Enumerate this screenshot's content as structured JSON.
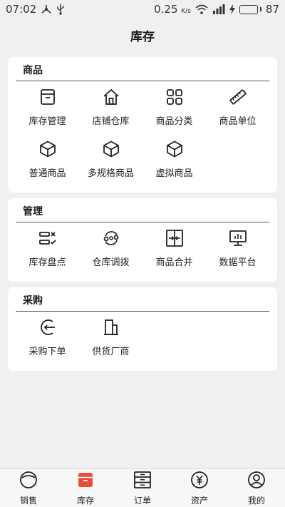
{
  "status_bar": {
    "time": "07:02",
    "speed": "0.25",
    "speed_unit": "K/s",
    "battery": "87"
  },
  "header": {
    "title": "库存"
  },
  "sections": [
    {
      "title": "商品",
      "items": [
        {
          "label": "库存管理",
          "icon": "box-icon"
        },
        {
          "label": "店铺仓库",
          "icon": "house-icon"
        },
        {
          "label": "商品分类",
          "icon": "grid-icon"
        },
        {
          "label": "商品单位",
          "icon": "ruler-icon"
        },
        {
          "label": "普通商品",
          "icon": "cube-icon"
        },
        {
          "label": "多规格商品",
          "icon": "cube-icon"
        },
        {
          "label": "虚拟商品",
          "icon": "cube-icon"
        }
      ]
    },
    {
      "title": "管理",
      "items": [
        {
          "label": "库存盘点",
          "icon": "checklist-icon"
        },
        {
          "label": "仓库调拨",
          "icon": "transfer-icon"
        },
        {
          "label": "商品合并",
          "icon": "merge-icon"
        },
        {
          "label": "数据平台",
          "icon": "monitor-icon"
        }
      ]
    },
    {
      "title": "采购",
      "items": [
        {
          "label": "采购下单",
          "icon": "order-icon"
        },
        {
          "label": "供货厂商",
          "icon": "building-icon"
        }
      ]
    }
  ],
  "bottom_nav": [
    {
      "label": "销售",
      "icon": "sales-icon"
    },
    {
      "label": "库存",
      "icon": "inventory-icon",
      "active": true
    },
    {
      "label": "订单",
      "icon": "orders-icon"
    },
    {
      "label": "资产",
      "icon": "assets-icon"
    },
    {
      "label": "我的",
      "icon": "profile-icon"
    }
  ],
  "colors": {
    "accent": "#e74c3c",
    "battery": "#2fbf2f"
  }
}
